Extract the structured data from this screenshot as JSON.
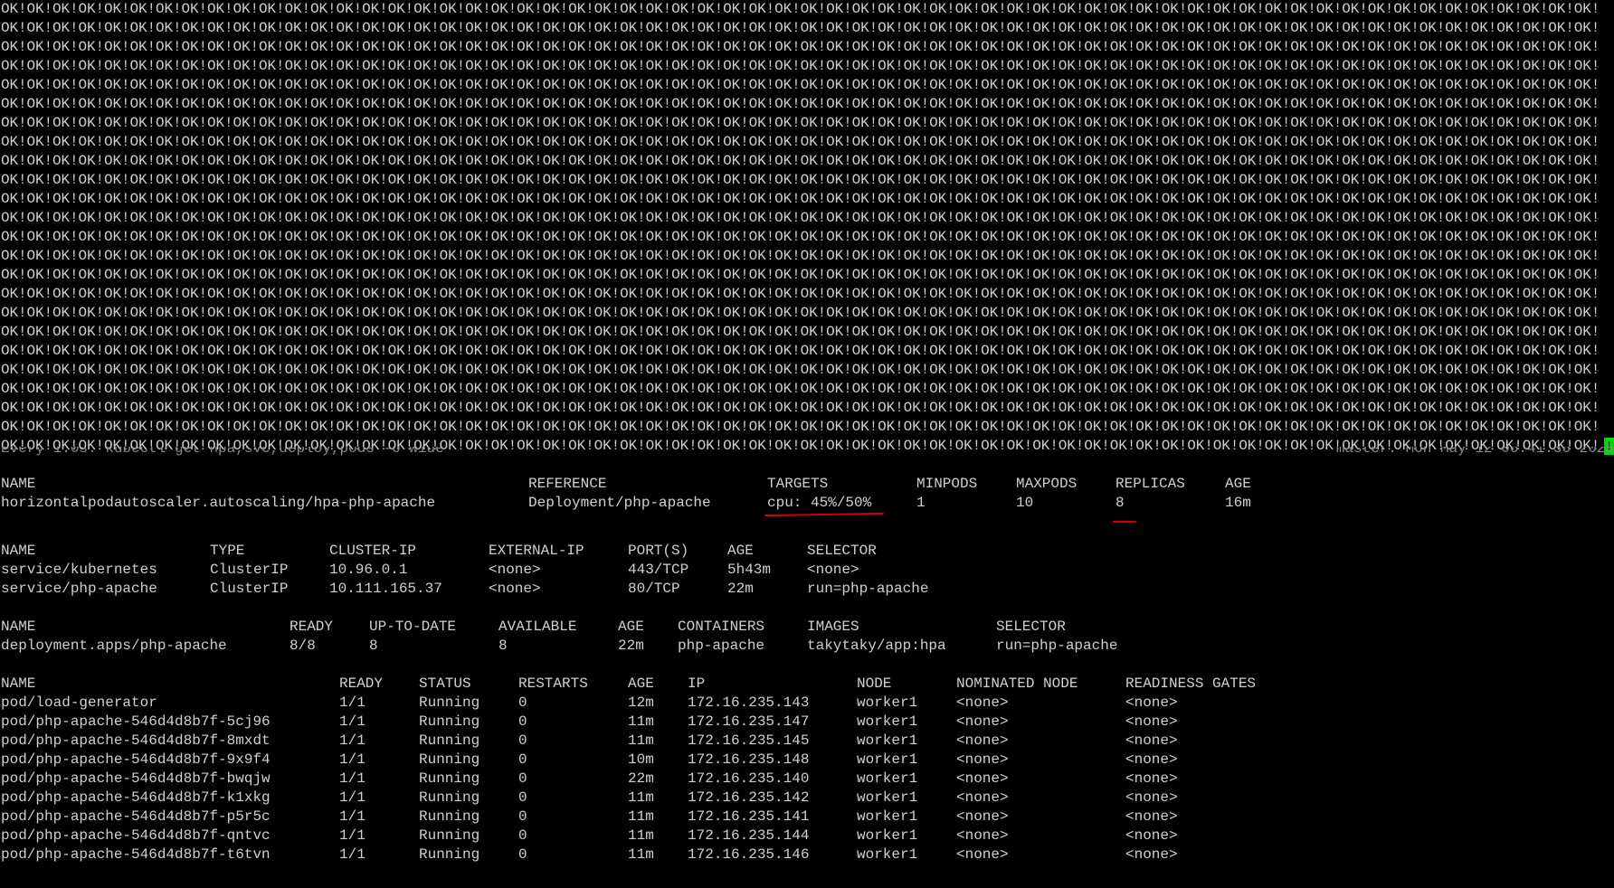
{
  "terminal": {
    "ok_text": "OK!OK!OK!OK!OK!OK!OK!OK!OK!OK!OK!OK!OK!OK!OK!OK!OK!OK!OK!OK!OK!OK!OK!OK!OK!OK!OK!OK!OK!OK!OK!OK!OK!OK!OK!OK!OK!OK!OK!OK!OK!OK!OK!OK!OK!OK!OK!OK!OK!OK!OK!OK!OK!OK!OK!OK!OK!OK!OK!OK!OK!OK!",
    "ok_line_count": 24,
    "cursor_char": "!",
    "cursor_color": "#00d800",
    "watch_command": "Every 1.0s: kubectl get hpa,svc,deploy,pods -o wide",
    "watch_host_time": "master: Mon May 12 06:41:36 2025",
    "annotation_color": "#d40000"
  },
  "hpa": {
    "headers": [
      "NAME",
      "REFERENCE",
      "TARGETS",
      "MINPODS",
      "MAXPODS",
      "REPLICAS",
      "AGE"
    ],
    "rows": [
      [
        "horizontalpodautoscaler.autoscaling/hpa-php-apache",
        "Deployment/php-apache",
        "cpu: 45%/50%",
        "1",
        "10",
        "8",
        "16m"
      ]
    ]
  },
  "svc": {
    "headers": [
      "NAME",
      "TYPE",
      "CLUSTER-IP",
      "EXTERNAL-IP",
      "PORT(S)",
      "AGE",
      "SELECTOR"
    ],
    "rows": [
      [
        "service/kubernetes",
        "ClusterIP",
        "10.96.0.1",
        "<none>",
        "443/TCP",
        "5h43m",
        "<none>"
      ],
      [
        "service/php-apache",
        "ClusterIP",
        "10.111.165.37",
        "<none>",
        "80/TCP",
        "22m",
        "run=php-apache"
      ]
    ]
  },
  "deploy": {
    "headers": [
      "NAME",
      "READY",
      "UP-TO-DATE",
      "AVAILABLE",
      "AGE",
      "CONTAINERS",
      "IMAGES",
      "SELECTOR"
    ],
    "rows": [
      [
        "deployment.apps/php-apache",
        "8/8",
        "8",
        "8",
        "22m",
        "php-apache",
        "takytaky/app:hpa",
        "run=php-apache"
      ]
    ]
  },
  "pods": {
    "headers": [
      "NAME",
      "READY",
      "STATUS",
      "RESTARTS",
      "AGE",
      "IP",
      "NODE",
      "NOMINATED NODE",
      "READINESS GATES"
    ],
    "rows": [
      [
        "pod/load-generator",
        "1/1",
        "Running",
        "0",
        "12m",
        "172.16.235.143",
        "worker1",
        "<none>",
        "<none>"
      ],
      [
        "pod/php-apache-546d4d8b7f-5cj96",
        "1/1",
        "Running",
        "0",
        "11m",
        "172.16.235.147",
        "worker1",
        "<none>",
        "<none>"
      ],
      [
        "pod/php-apache-546d4d8b7f-8mxdt",
        "1/1",
        "Running",
        "0",
        "11m",
        "172.16.235.145",
        "worker1",
        "<none>",
        "<none>"
      ],
      [
        "pod/php-apache-546d4d8b7f-9x9f4",
        "1/1",
        "Running",
        "0",
        "10m",
        "172.16.235.148",
        "worker1",
        "<none>",
        "<none>"
      ],
      [
        "pod/php-apache-546d4d8b7f-bwqjw",
        "1/1",
        "Running",
        "0",
        "22m",
        "172.16.235.140",
        "worker1",
        "<none>",
        "<none>"
      ],
      [
        "pod/php-apache-546d4d8b7f-k1xkg",
        "1/1",
        "Running",
        "0",
        "11m",
        "172.16.235.142",
        "worker1",
        "<none>",
        "<none>"
      ],
      [
        "pod/php-apache-546d4d8b7f-p5r5c",
        "1/1",
        "Running",
        "0",
        "11m",
        "172.16.235.141",
        "worker1",
        "<none>",
        "<none>"
      ],
      [
        "pod/php-apache-546d4d8b7f-qntvc",
        "1/1",
        "Running",
        "0",
        "11m",
        "172.16.235.144",
        "worker1",
        "<none>",
        "<none>"
      ],
      [
        "pod/php-apache-546d4d8b7f-t6tvn",
        "1/1",
        "Running",
        "0",
        "11m",
        "172.16.235.146",
        "worker1",
        "<none>",
        "<none>"
      ]
    ]
  }
}
